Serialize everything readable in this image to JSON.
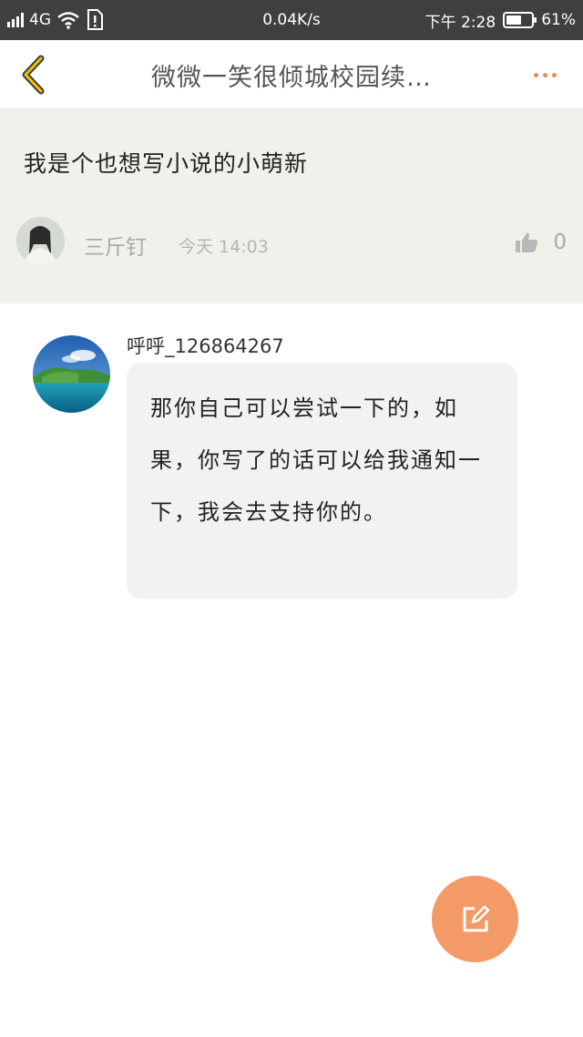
{
  "status_bar": {
    "network": "4G",
    "speed": "0.04K/s",
    "time": "下午 2:28",
    "battery": "61%",
    "battery_level": 0.61
  },
  "nav": {
    "title": "微微一笑很倾城校园续…",
    "accent_color": "#f0884f"
  },
  "post": {
    "text": "我是个也想写小说的小萌新",
    "author": "三斤钉",
    "time": "今天 14:03",
    "likes": "0"
  },
  "reply": {
    "username": "呼呼_126864267",
    "message": "那你自己可以尝试一下的，如果，你写了的话可以给我通知一下，我会去支持你的。"
  },
  "fab": {
    "icon": "edit-icon",
    "color": "#f49a66"
  }
}
